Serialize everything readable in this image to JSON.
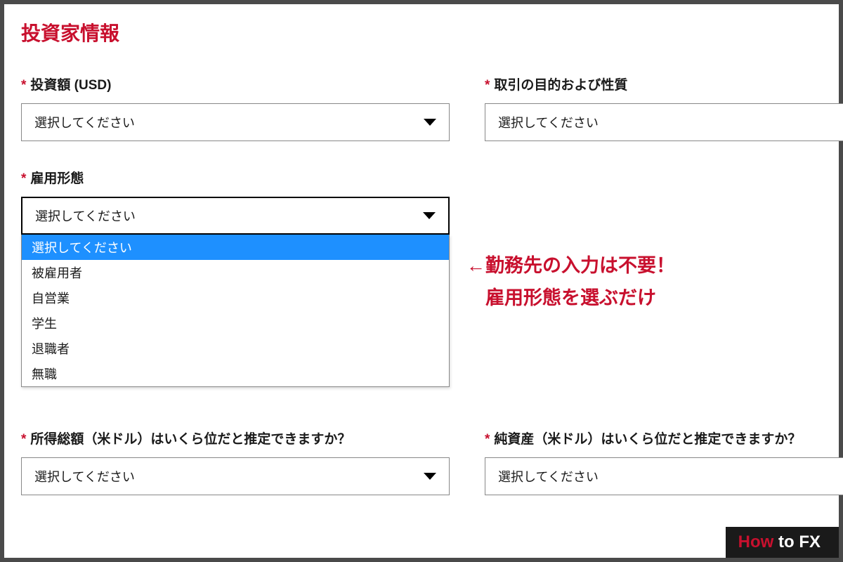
{
  "section_title": "投資家情報",
  "asterisk": "*",
  "fields": {
    "investment_amount": {
      "label": "投資額 (USD)",
      "placeholder": "選択してください"
    },
    "trading_purpose": {
      "label": "取引の目的および性質",
      "placeholder": "選択してください"
    },
    "employment": {
      "label": "雇用形態",
      "placeholder": "選択してください",
      "options": [
        "選択してください",
        "被雇用者",
        "自営業",
        "学生",
        "退職者",
        "無職"
      ]
    },
    "income": {
      "label": "所得総額（米ドル）はいくら位だと推定できますか？",
      "placeholder": "選択してください"
    },
    "networth": {
      "label": "純資産（米ドル）はいくら位だと推定できますか？",
      "placeholder": "選択してください"
    }
  },
  "annotation": {
    "line1": "←勤務先の入力は不要！",
    "line2": "　雇用形態を選ぶだけ"
  },
  "watermark": {
    "how": "How ",
    "tofx": "to FX"
  }
}
